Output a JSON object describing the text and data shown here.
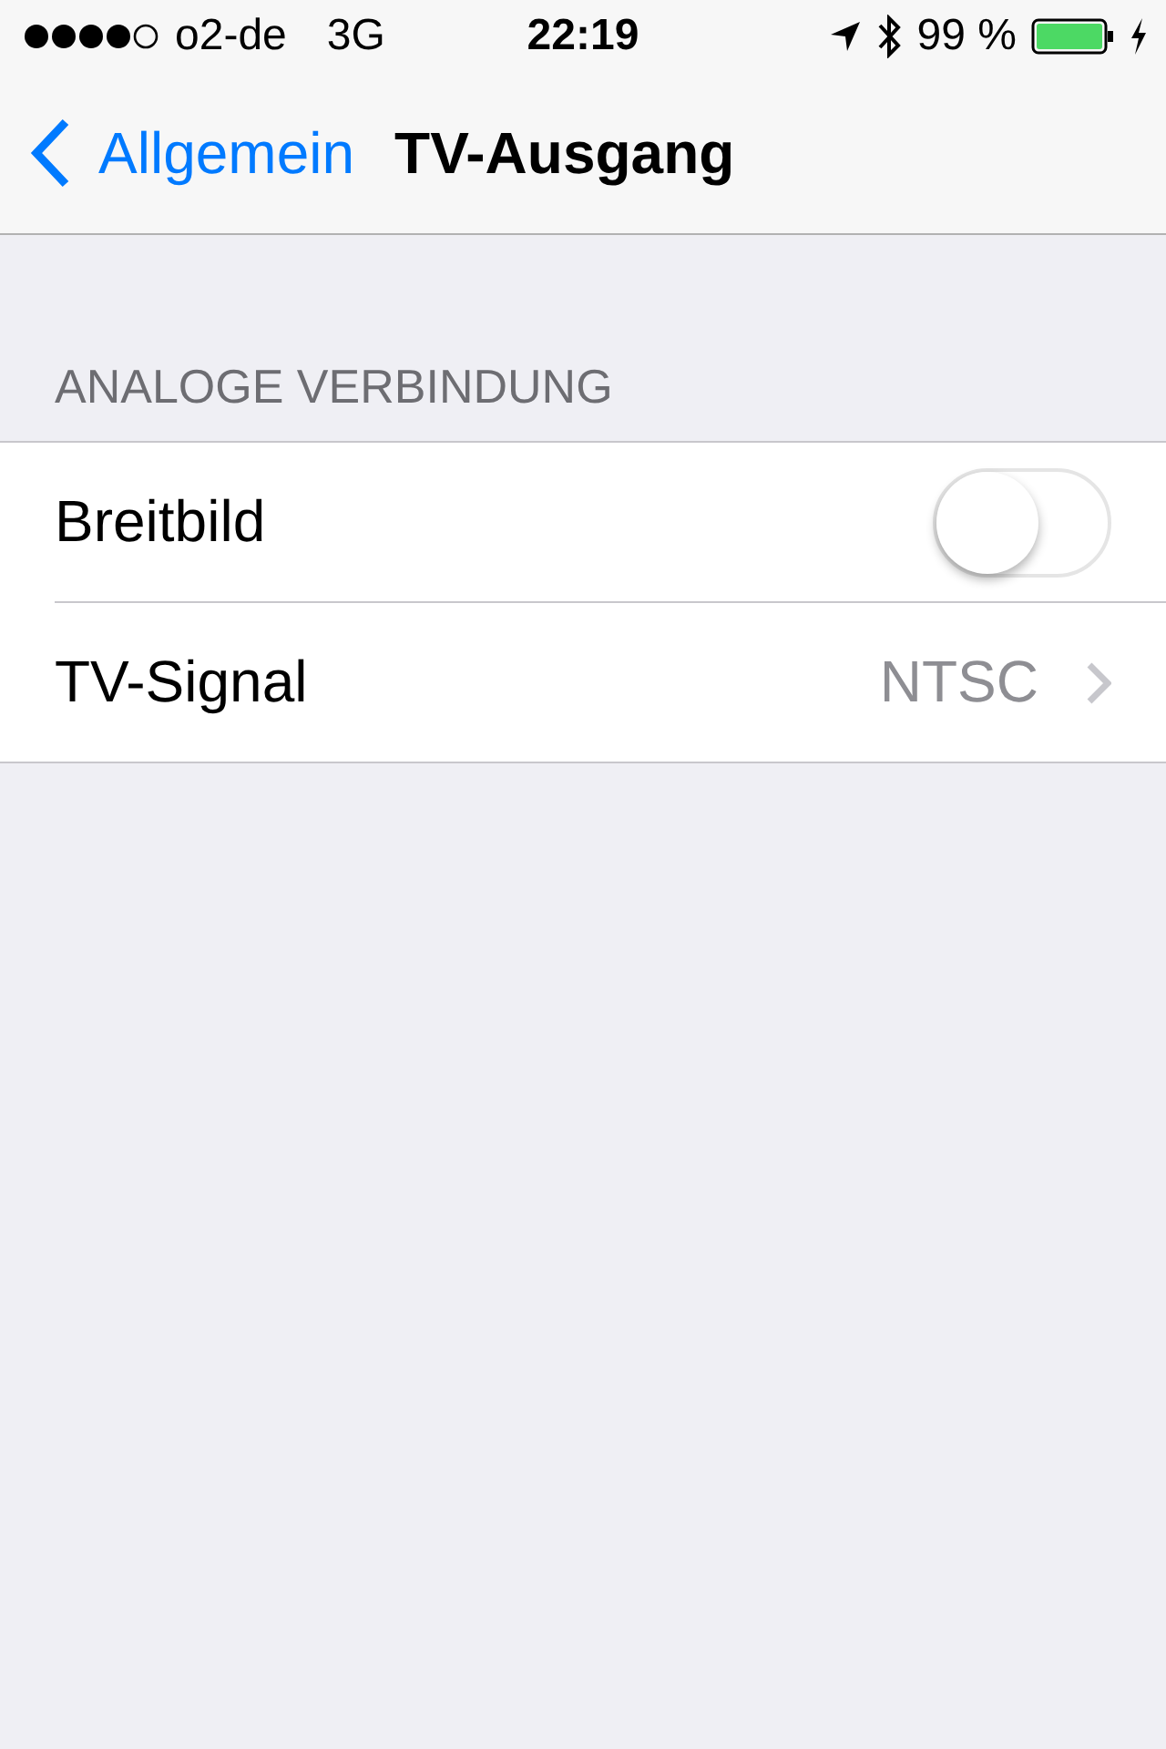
{
  "status_bar": {
    "carrier": "o2-de",
    "network": "3G",
    "time": "22:19",
    "battery": "99 %"
  },
  "nav": {
    "back": "Allgemein",
    "title": "TV-Ausgang"
  },
  "section": {
    "header": "ANALOGE VERBINDUNG",
    "rows": [
      {
        "kind": "toggle",
        "label": "Breitbild",
        "on": false
      },
      {
        "kind": "disclosure",
        "label": "TV-Signal",
        "value": "NTSC"
      }
    ]
  }
}
